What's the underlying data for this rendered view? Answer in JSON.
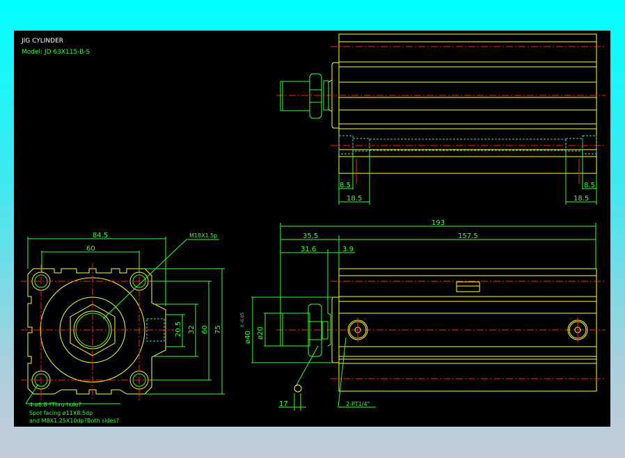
{
  "title": "JIG CYLINDER",
  "model": "Model: JD 63X115-B-S",
  "colors": {
    "background_top": "#00ffff",
    "canvas": "#000000",
    "outline": "#ffff33",
    "dimension": "#33ff33",
    "centerline": "#ff2020",
    "hidden": "#33dddd"
  },
  "top_view": {
    "dims": [
      "8.5",
      "18.5",
      "8.5",
      "18.5"
    ]
  },
  "side_view": {
    "dims": {
      "overall": "193",
      "rod_end": "35.5",
      "body": "157.5",
      "rod_len": "31.6",
      "gap": "3.9",
      "boss_dia": "ø40",
      "boss_tol": "0 -0.05",
      "rod_dia": "ø20",
      "nut": "17"
    },
    "port_note": "2-PT1/4\""
  },
  "end_view": {
    "dims": {
      "width": "84.5",
      "pitch": "60",
      "d1": "20.5",
      "d2": "32",
      "d3": "60",
      "d4": "75"
    },
    "thread_note": "M18X1.5p",
    "hole_notes": [
      "4-ø6.8 ?Thru-hole?",
      "Spot facing ø11X8.5dp",
      "and M8X1.25X10dp?Both sides?"
    ]
  }
}
